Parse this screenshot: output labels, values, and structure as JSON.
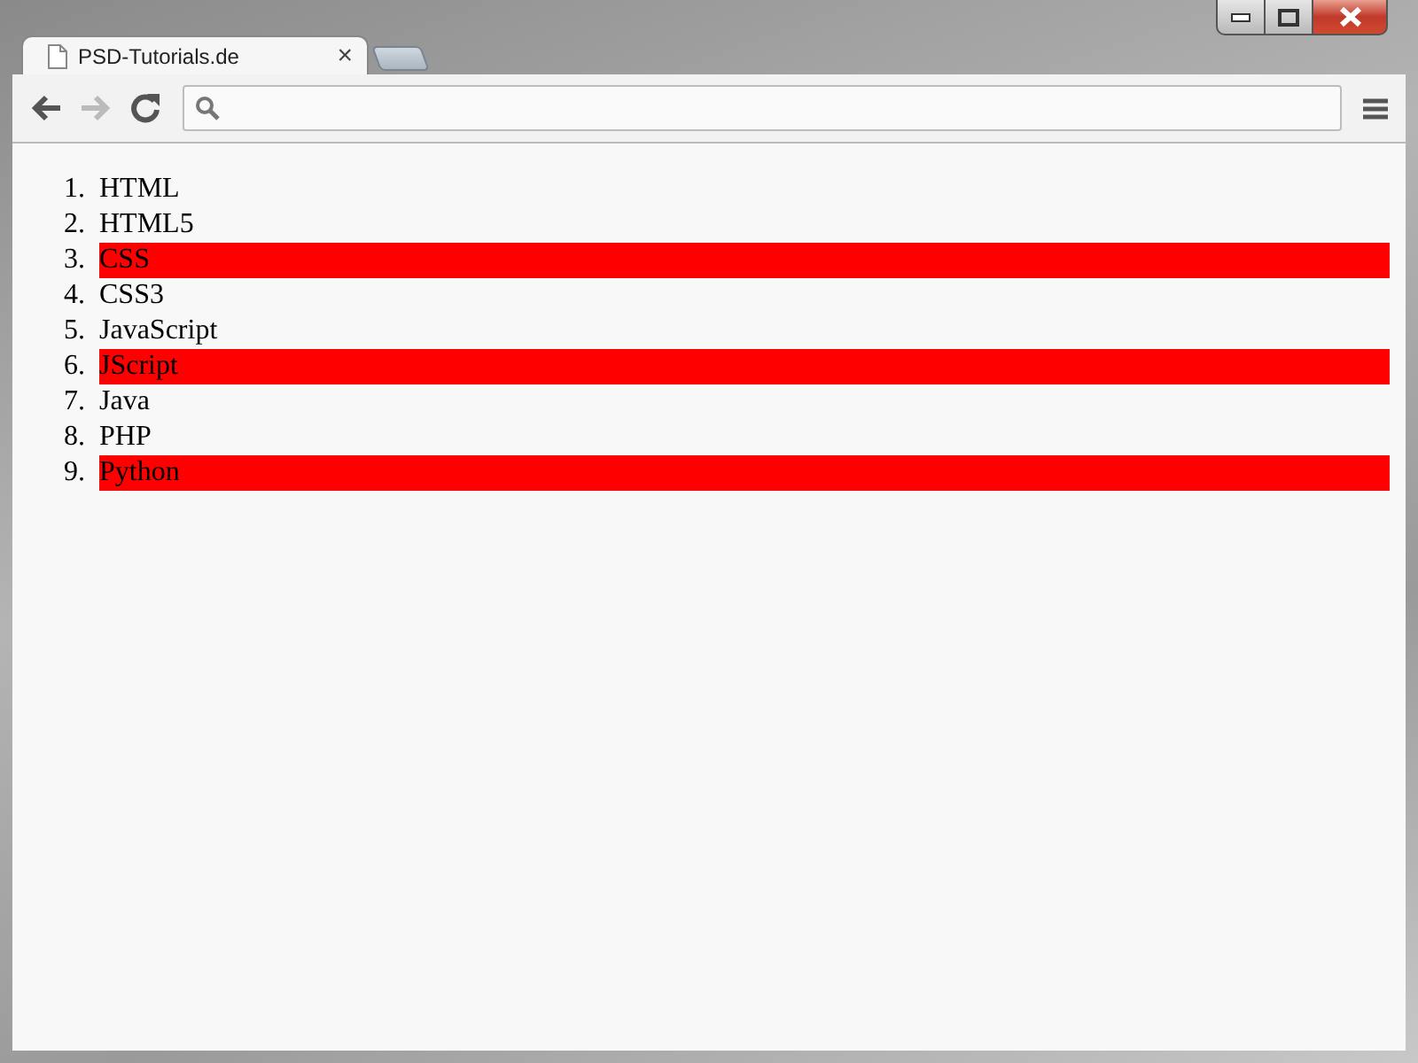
{
  "tab": {
    "title": "PSD-Tutorials.de",
    "close": "×"
  },
  "list": [
    {
      "number": "1.",
      "text": "HTML",
      "highlighted": false
    },
    {
      "number": "2.",
      "text": "HTML5",
      "highlighted": false
    },
    {
      "number": "3.",
      "text": "CSS",
      "highlighted": true
    },
    {
      "number": "4.",
      "text": "CSS3",
      "highlighted": false
    },
    {
      "number": "5.",
      "text": "JavaScript",
      "highlighted": false
    },
    {
      "number": "6.",
      "text": "JScript",
      "highlighted": true
    },
    {
      "number": "7.",
      "text": "Java",
      "highlighted": false
    },
    {
      "number": "8.",
      "text": "PHP",
      "highlighted": false
    },
    {
      "number": "9.",
      "text": "Python",
      "highlighted": true
    }
  ]
}
